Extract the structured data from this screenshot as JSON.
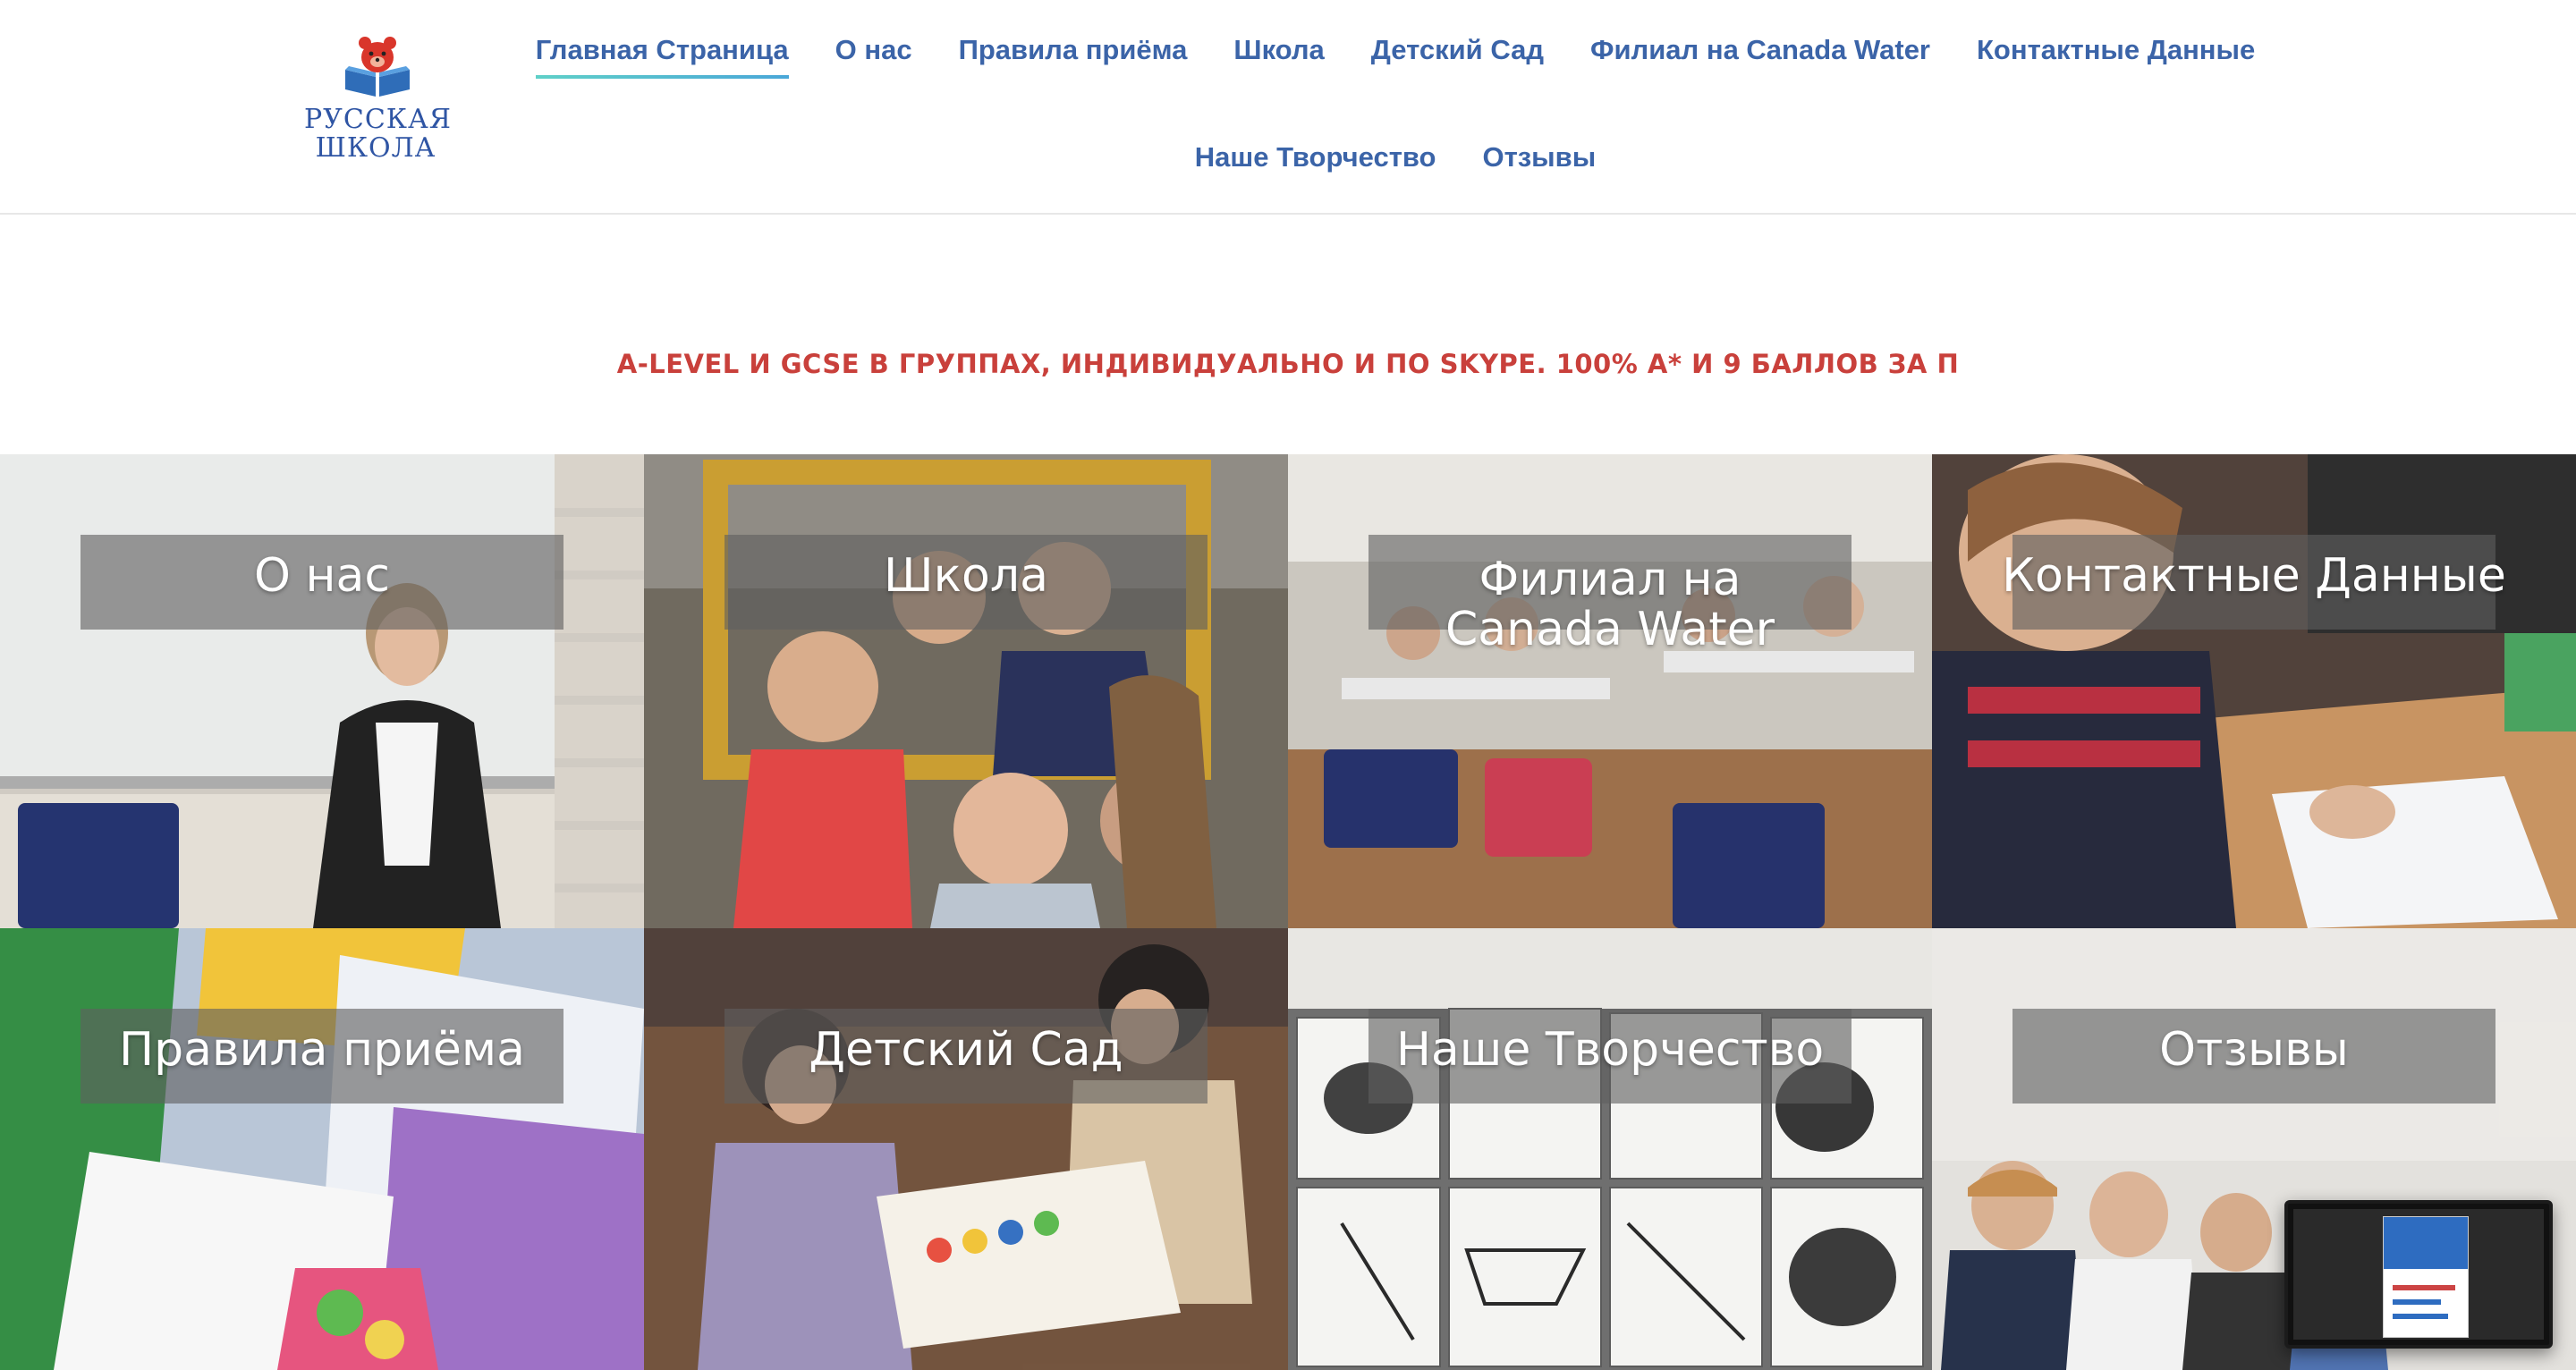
{
  "logo": {
    "line1": "РУССКАЯ",
    "line2": "ШКОЛА"
  },
  "nav": {
    "row1": [
      {
        "label": "Главная Страница",
        "active": true
      },
      {
        "label": "О нас"
      },
      {
        "label": "Правила приёма"
      },
      {
        "label": "Школа"
      },
      {
        "label": "Детский Сад"
      },
      {
        "label": "Филиал на Canada Water"
      },
      {
        "label": "Контактные Данные"
      }
    ],
    "row2": [
      {
        "label": "Наше Творчество"
      },
      {
        "label": "Отзывы"
      }
    ]
  },
  "banner": {
    "text": "A-LEVEL И GCSE В ГРУППАХ, ИНДИВИДУАЛЬНО И ПО SKYPE. 100% A* И 9 БАЛЛОВ ЗА П"
  },
  "tiles": [
    {
      "label": "О нас"
    },
    {
      "label": "Школа"
    },
    {
      "label": "Филиал на Canada Water"
    },
    {
      "label": "Контактные Данные"
    },
    {
      "label": "Правила приёма"
    },
    {
      "label": "Детский Сад"
    },
    {
      "label": "Наше Творчество"
    },
    {
      "label": "Отзывы"
    }
  ],
  "colors": {
    "nav_text": "#3b64a8",
    "nav_active_underline": "#5fd0c8",
    "banner_text": "#c9403b",
    "tile_label_box": "#5f5f5f"
  },
  "icons": [
    "bear-book-logo-icon"
  ]
}
